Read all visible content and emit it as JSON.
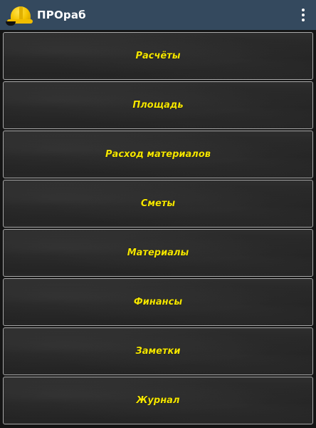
{
  "app_bar": {
    "title": "ПРОраб",
    "icon": "hard-hat-icon",
    "menu_icon": "more-vertical-icon"
  },
  "menu": {
    "items": [
      {
        "id": "calculations",
        "label": "Расчёты"
      },
      {
        "id": "area",
        "label": "Площадь"
      },
      {
        "id": "material-consumption",
        "label": "Расход материалов"
      },
      {
        "id": "estimates",
        "label": "Сметы"
      },
      {
        "id": "materials",
        "label": "Материалы"
      },
      {
        "id": "finance",
        "label": "Финансы"
      },
      {
        "id": "notes",
        "label": "Заметки"
      },
      {
        "id": "journal",
        "label": "Журнал"
      }
    ]
  },
  "colors": {
    "app_bar": "#34495e",
    "label": "#f5e600",
    "tile_border": "#a8a8a8",
    "background": "#141414"
  }
}
